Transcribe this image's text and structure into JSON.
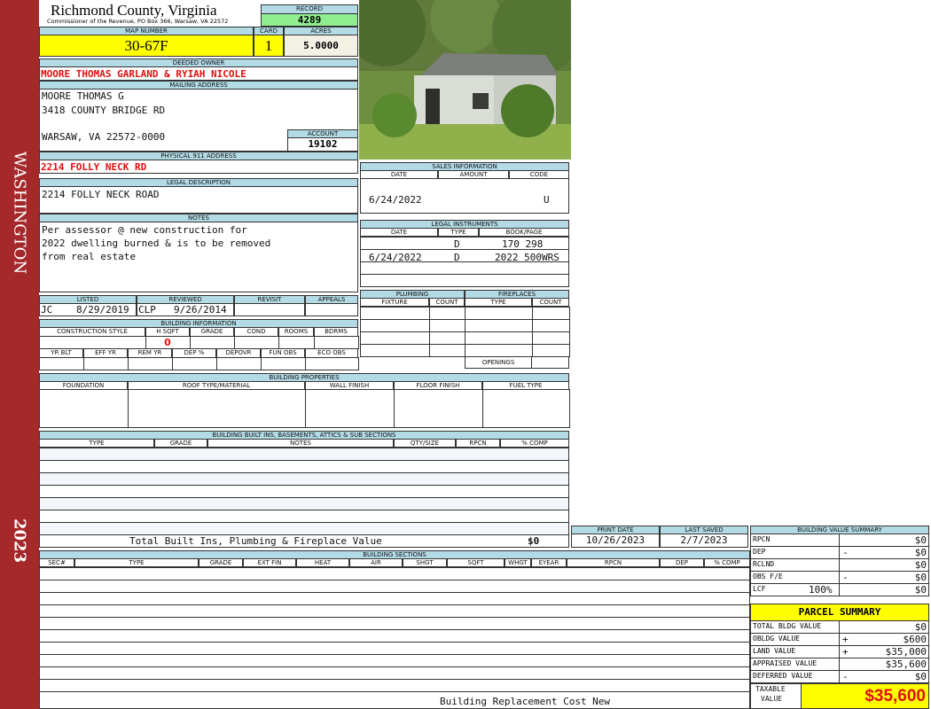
{
  "side": {
    "county_label": "WASHINGTON",
    "year": "2023"
  },
  "header": {
    "title": "Richmond County, Virginia",
    "subtitle": "Commissioner of the Revenue, PO Box 366, Warsaw, VA 22572",
    "record_label": "RECORD",
    "record": "4289",
    "map_label": "MAP NUMBER",
    "map": "30-67F",
    "card_label": "CARD",
    "card": "1",
    "acres_label": "ACRES",
    "acres": "5.0000"
  },
  "owner": {
    "label": "DEEDED OWNER",
    "value": "MOORE THOMAS GARLAND & RYIAH NICOLE"
  },
  "mailing": {
    "label": "MAILING ADDRESS",
    "line1": "MOORE THOMAS G",
    "line2": "3418 COUNTY BRIDGE RD",
    "line3": "WARSAW, VA 22572-0000",
    "account_label": "ACCOUNT",
    "account": "19102"
  },
  "physical": {
    "label": "PHYSICAL 911 ADDRESS",
    "value": "2214 FOLLY NECK RD"
  },
  "legal": {
    "label": "LEGAL DESCRIPTION",
    "value": "2214 FOLLY NECK ROAD"
  },
  "notes": {
    "label": "NOTES",
    "line1": "Per assessor @ new construction for",
    "line2": "2022 dwelling burned & is to be removed",
    "line3": "from real estate"
  },
  "listing": {
    "listed_label": "LISTED",
    "listed_by": "JC",
    "listed_date": "8/29/2019",
    "reviewed_label": "REVIEWED",
    "reviewed_by": "CLP",
    "reviewed_date": "9/26/2014",
    "revisit_label": "REVISIT",
    "appeals_label": "APPEALS"
  },
  "building_info": {
    "label": "BUILDING INFORMATION",
    "cols1": [
      "CONSTRUCTION STYLE",
      "H SQFT",
      "GRADE",
      "COND",
      "ROOMS",
      "BDRMS"
    ],
    "hsqft": "0",
    "cols2": [
      "YR BLT",
      "EFF YR",
      "REM YR",
      "DEP %",
      "DEPOVR",
      "FUN OBS",
      "ECO OBS"
    ]
  },
  "sales": {
    "label": "SALES INFORMATION",
    "cols": [
      "DATE",
      "AMOUNT",
      "CODE"
    ],
    "rows": [
      {
        "date": "6/24/2022",
        "amount": "",
        "code": "U"
      }
    ]
  },
  "instruments": {
    "label": "LEGAL INSTRUMENTS",
    "cols": [
      "DATE",
      "TYPE",
      "BOOK/PAGE"
    ],
    "rows": [
      {
        "date": "",
        "type": "D",
        "book": "170 298"
      },
      {
        "date": "6/24/2022",
        "type": "D",
        "book": "2022 500WRS"
      }
    ]
  },
  "plumbing": {
    "label": "PLUMBING",
    "cols": [
      "FIXTURE",
      "COUNT"
    ]
  },
  "fireplaces": {
    "label": "FIREPLACES",
    "cols": [
      "TYPE",
      "COUNT"
    ],
    "openings": "OPENINGS"
  },
  "properties": {
    "label": "BUILDING PROPERTIES",
    "cols": [
      "FOUNDATION",
      "ROOF TYPE/MATERIAL",
      "WALL FINISH",
      "FLOOR FINISH",
      "FUEL TYPE"
    ]
  },
  "builtins": {
    "label": "BUILDING BUILT INS, BASEMENTS, ATTICS & SUB SECTIONS",
    "cols": [
      "TYPE",
      "GRADE",
      "NOTES",
      "QTY/SIZE",
      "RPCN",
      "% COMP"
    ],
    "total_label": "Total Built Ins, Plumbing & Fireplace Value",
    "total": "$0"
  },
  "dates": {
    "print_label": "PRINT DATE",
    "print": "10/26/2023",
    "saved_label": "LAST SAVED",
    "saved": "2/7/2023"
  },
  "sections": {
    "label": "BUILDING SECTIONS",
    "cols": [
      "SEC#",
      "TYPE",
      "GRADE",
      "EXT FIN",
      "HEAT",
      "AIR",
      "SHGT",
      "SQFT",
      "WHGT",
      "EYEAR",
      "RPCN",
      "DEP",
      "% COMP"
    ],
    "footer": "Building Replacement Cost New"
  },
  "bvs": {
    "label": "BUILDING VALUE SUMMARY",
    "rows": [
      {
        "k": "RPCN",
        "s": "",
        "v": "$0"
      },
      {
        "k": "DEP",
        "s": "-",
        "v": "$0"
      },
      {
        "k": "RCLND",
        "s": "",
        "v": "$0"
      },
      {
        "k": "OBS F/E",
        "s": "-",
        "v": "$0"
      },
      {
        "k": "LCF",
        "p": "100%",
        "s": "",
        "v": "$0"
      }
    ]
  },
  "parcel": {
    "label": "PARCEL SUMMARY",
    "rows": [
      {
        "k": "TOTAL BLDG VALUE",
        "s": "",
        "v": "$0"
      },
      {
        "k": "OBLDG VALUE",
        "s": "+",
        "v": "$600"
      },
      {
        "k": "LAND VALUE",
        "s": "+",
        "v": "$35,000"
      },
      {
        "k": "APPRAISED VALUE",
        "s": "",
        "v": "$35,600"
      },
      {
        "k": "DEFERRED VALUE",
        "s": "-",
        "v": "$0"
      }
    ],
    "taxable_label1": "TAXABLE",
    "taxable_label2": "VALUE",
    "taxable": "$35,600"
  },
  "colors": {
    "side": "#a5282b",
    "header": "#b3dbe6",
    "yellow": "#ffff00",
    "green": "#90ee90",
    "red": "#e01010"
  }
}
